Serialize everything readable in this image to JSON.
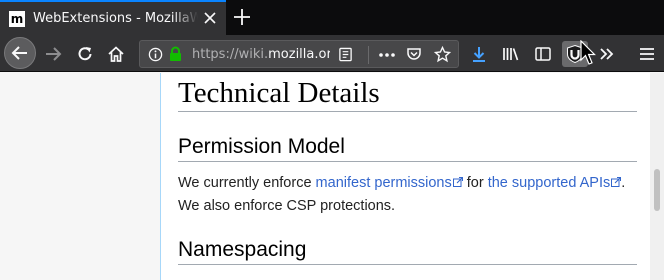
{
  "tab": {
    "favicon_letter": "m",
    "title": "WebExtensions - MozillaWiki"
  },
  "navbar": {
    "url_prefix": "https://wiki.",
    "url_host": "mozilla.org"
  },
  "article": {
    "heading_main": "Technical Details",
    "heading_permission": "Permission Model",
    "para_1": "We currently enforce ",
    "link_manifest": "manifest permissions",
    "para_2": " for ",
    "link_supported": "the supported APIs",
    "para_3": ". We also enforce CSP protections.",
    "heading_namespacing": "Namespacing"
  },
  "colors": {
    "accent": "#0a84ff",
    "link": "#3366cc",
    "toolbar": "#323234",
    "tabstrip": "#0c0c0d",
    "secure_lock": "#12bc00"
  },
  "icons": [
    "close-icon",
    "plus-icon",
    "arrow-left-icon",
    "arrow-right-icon",
    "reload-icon",
    "home-icon",
    "info-icon",
    "lock-icon",
    "reader-view-icon",
    "more-icon",
    "pocket-icon",
    "star-icon",
    "download-icon",
    "library-icon",
    "sidebar-icon",
    "ublock-icon",
    "overflow-icon",
    "hamburger-icon",
    "external-link-icon"
  ]
}
